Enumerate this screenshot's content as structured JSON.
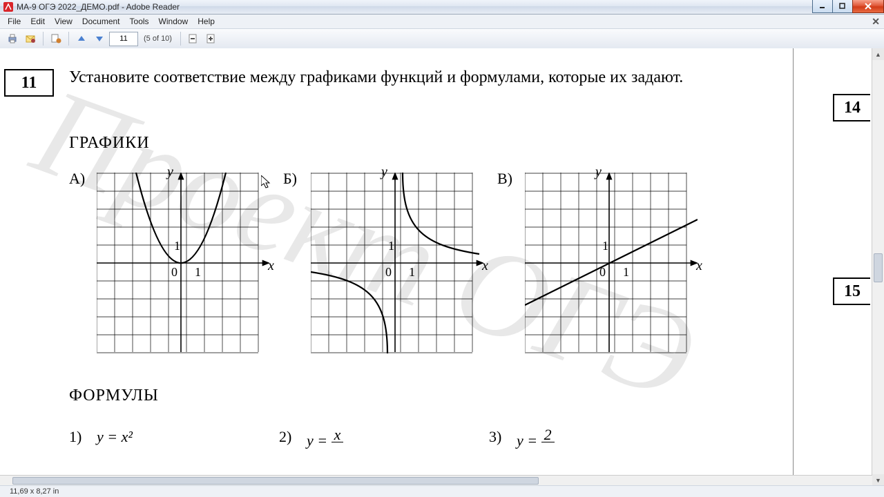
{
  "window": {
    "title": "МА-9 ОГЭ 2022_ДЕМО.pdf - Adobe Reader"
  },
  "menu": {
    "file": "File",
    "edit": "Edit",
    "view": "View",
    "document": "Document",
    "tools": "Tools",
    "window": "Window",
    "help": "Help"
  },
  "toolbar": {
    "page_current": "11",
    "page_count": "(5 of 10)"
  },
  "status": {
    "dims": "11,69 x 8,27 in"
  },
  "doc": {
    "q11": "11",
    "task": "Установите соответствие между графиками функций и формулами, которые их задают.",
    "sec_graphs": "ГРАФИКИ",
    "sec_formulas": "ФОРМУЛЫ",
    "lblA": "А)",
    "lblB": "Б)",
    "lblV": "В)",
    "f1n": "1)",
    "f2n": "2)",
    "f3n": "3)",
    "f1": "y = x²",
    "f2_left": "y = ",
    "f2_num": "x",
    "f3_left": "y = ",
    "f3_num": "2",
    "y": "y",
    "x": "x",
    "zero": "0",
    "one": "1",
    "q14": "14",
    "q15": "15"
  },
  "chart_data": [
    {
      "type": "line",
      "name": "A",
      "fn": "y=x^2",
      "x_range": [
        -4,
        4
      ],
      "y_range": [
        -4,
        6
      ],
      "sample": [
        [
          -2.5,
          6.25
        ],
        [
          -2,
          4
        ],
        [
          -1,
          1
        ],
        [
          0,
          0
        ],
        [
          1,
          1
        ],
        [
          2,
          4
        ],
        [
          2.5,
          6.25
        ]
      ]
    },
    {
      "type": "line",
      "name": "Б",
      "fn": "y=2/x",
      "x_range": [
        -4,
        4
      ],
      "y_range": [
        -4,
        6
      ],
      "sample_neg": [
        [
          -4,
          -0.5
        ],
        [
          -2,
          -1
        ],
        [
          -1,
          -2
        ],
        [
          -0.5,
          -4
        ]
      ],
      "sample_pos": [
        [
          0.5,
          4
        ],
        [
          1,
          2
        ],
        [
          2,
          1
        ],
        [
          4,
          0.5
        ]
      ]
    },
    {
      "type": "line",
      "name": "В",
      "fn": "y=x/2",
      "x_range": [
        -4,
        4
      ],
      "y_range": [
        -4,
        6
      ],
      "sample": [
        [
          -4,
          -2
        ],
        [
          0,
          0
        ],
        [
          4,
          2
        ]
      ]
    }
  ]
}
